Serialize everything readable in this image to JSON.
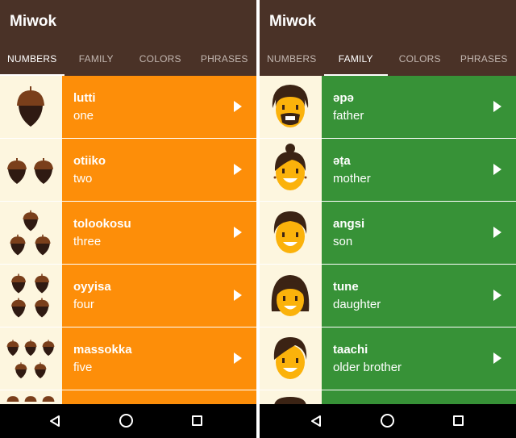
{
  "screens": [
    {
      "app_title": "Miwok",
      "tabs": [
        {
          "label": "NUMBERS",
          "active": true
        },
        {
          "label": "FAMILY",
          "active": false
        },
        {
          "label": "COLORS",
          "active": false
        },
        {
          "label": "PHRASES",
          "active": false
        }
      ],
      "category": "numbers",
      "item_color": "#fd8e09",
      "items": [
        {
          "word": "lutti",
          "translation": "one",
          "icon": "acorn-1-icon",
          "count": 1
        },
        {
          "word": "otiiko",
          "translation": "two",
          "icon": "acorn-2-icon",
          "count": 2
        },
        {
          "word": "tolookosu",
          "translation": "three",
          "icon": "acorn-3-icon",
          "count": 3
        },
        {
          "word": "oyyisa",
          "translation": "four",
          "icon": "acorn-4-icon",
          "count": 4
        },
        {
          "word": "massokka",
          "translation": "five",
          "icon": "acorn-5-icon",
          "count": 5
        }
      ]
    },
    {
      "app_title": "Miwok",
      "tabs": [
        {
          "label": "NUMBERS",
          "active": false
        },
        {
          "label": "FAMILY",
          "active": true
        },
        {
          "label": "COLORS",
          "active": false
        },
        {
          "label": "PHRASES",
          "active": false
        }
      ],
      "category": "family",
      "item_color": "#379237",
      "items": [
        {
          "word": "әpә",
          "translation": "father",
          "icon": "father-face-icon"
        },
        {
          "word": "әṭa",
          "translation": "mother",
          "icon": "mother-face-icon"
        },
        {
          "word": "angsi",
          "translation": "son",
          "icon": "son-face-icon"
        },
        {
          "word": "tune",
          "translation": "daughter",
          "icon": "daughter-face-icon"
        },
        {
          "word": "taachi",
          "translation": "older brother",
          "icon": "older-brother-face-icon"
        }
      ]
    }
  ],
  "colors": {
    "appbar": "#4a3227",
    "numbers": "#fd8e09",
    "family": "#379237",
    "thumb_bg": "#fdf6df",
    "acorn_cap": "#7a3f1b",
    "acorn_body": "#2f1a12",
    "skin": "#fbb20b",
    "hair": "#3b2314"
  }
}
